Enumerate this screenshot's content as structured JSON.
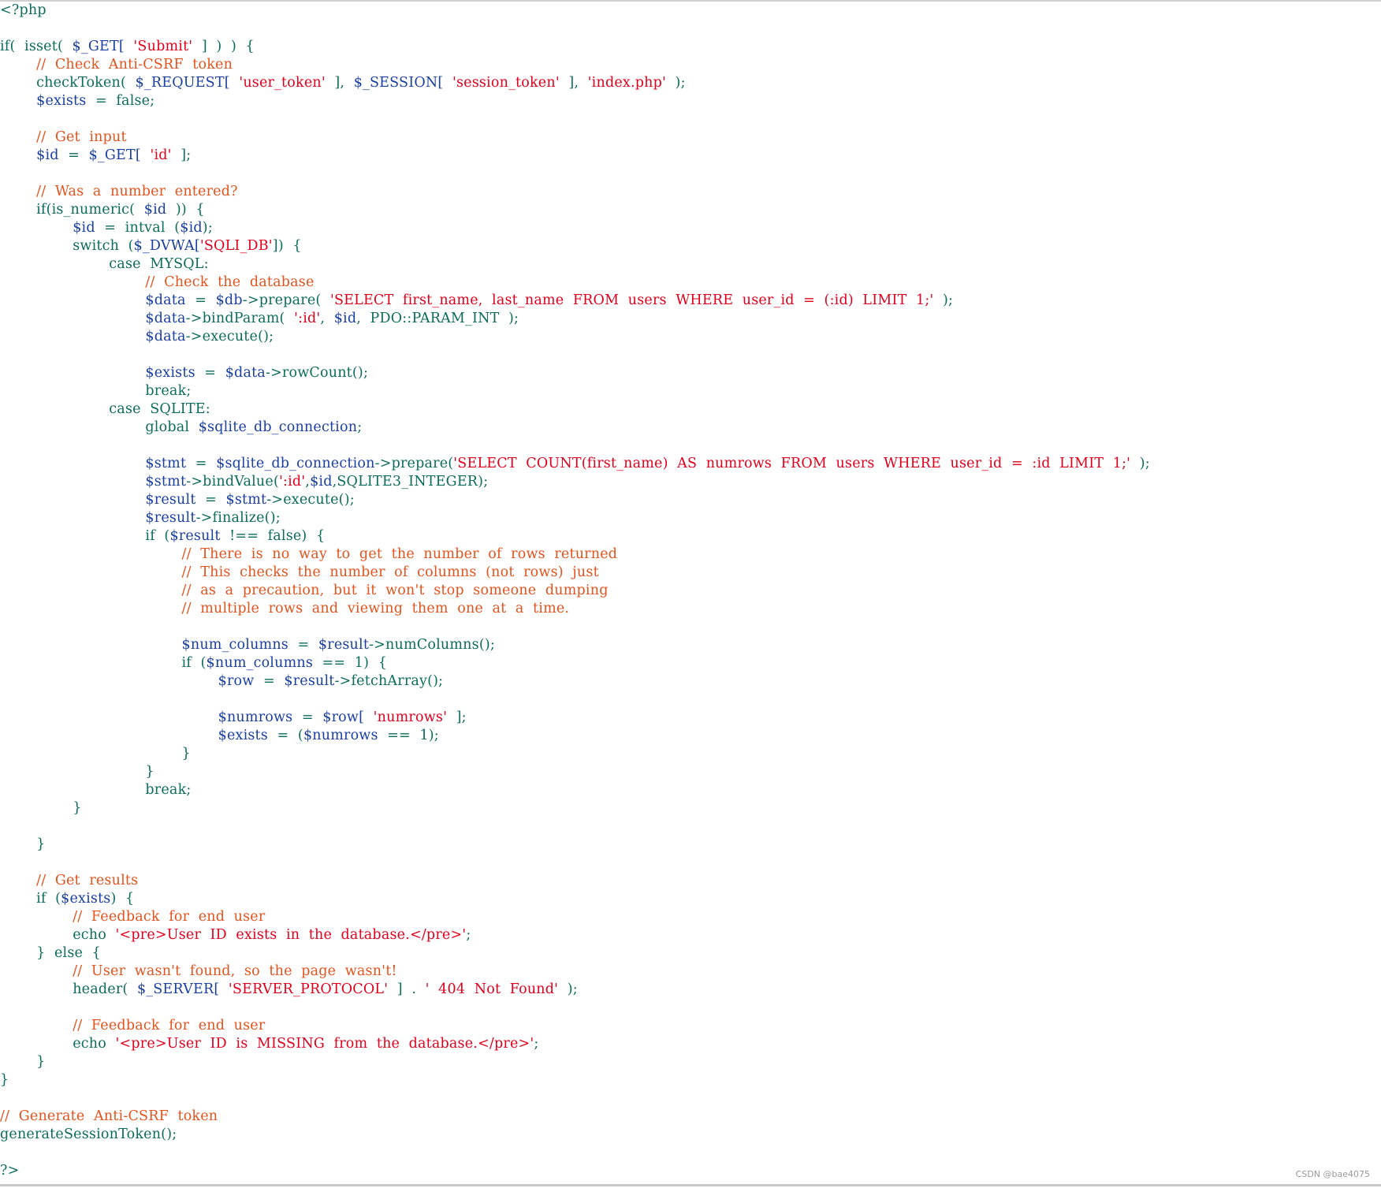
{
  "editor": {
    "lines": [
      [
        {
          "t": "<?php",
          "c": "default"
        }
      ],
      [],
      [
        {
          "t": "if(  isset(  ",
          "c": "default"
        },
        {
          "t": "$_GET[",
          "c": "variable"
        },
        {
          "t": "  ",
          "c": "default"
        },
        {
          "t": "'Submit'",
          "c": "string"
        },
        {
          "t": "  ]  )  )  {",
          "c": "default"
        }
      ],
      [
        {
          "t": "        //  Check  Anti-CSRF  token",
          "c": "comment"
        }
      ],
      [
        {
          "t": "        checkToken(  ",
          "c": "default"
        },
        {
          "t": "$_REQUEST[",
          "c": "variable"
        },
        {
          "t": "  ",
          "c": "default"
        },
        {
          "t": "'user_token'",
          "c": "string"
        },
        {
          "t": "  ],  ",
          "c": "default"
        },
        {
          "t": "$_SESSION[",
          "c": "variable"
        },
        {
          "t": "  ",
          "c": "default"
        },
        {
          "t": "'session_token'",
          "c": "string"
        },
        {
          "t": "  ],  ",
          "c": "default"
        },
        {
          "t": "'index.php'",
          "c": "string"
        },
        {
          "t": "  );",
          "c": "default"
        }
      ],
      [
        {
          "t": "        ",
          "c": "default"
        },
        {
          "t": "$exists",
          "c": "variable"
        },
        {
          "t": "  =  false;",
          "c": "default"
        }
      ],
      [],
      [
        {
          "t": "        //  Get  input",
          "c": "comment"
        }
      ],
      [
        {
          "t": "        ",
          "c": "default"
        },
        {
          "t": "$id",
          "c": "variable"
        },
        {
          "t": "  =  ",
          "c": "default"
        },
        {
          "t": "$_GET[",
          "c": "variable"
        },
        {
          "t": "  ",
          "c": "default"
        },
        {
          "t": "'id'",
          "c": "string"
        },
        {
          "t": "  ];",
          "c": "default"
        }
      ],
      [],
      [
        {
          "t": "        //  Was  a  number  entered?",
          "c": "comment"
        }
      ],
      [
        {
          "t": "        if(is_numeric(  ",
          "c": "default"
        },
        {
          "t": "$id",
          "c": "variable"
        },
        {
          "t": "  ))  {",
          "c": "default"
        }
      ],
      [
        {
          "t": "                ",
          "c": "default"
        },
        {
          "t": "$id",
          "c": "variable"
        },
        {
          "t": "  =  intval  (",
          "c": "default"
        },
        {
          "t": "$id",
          "c": "variable"
        },
        {
          "t": ");",
          "c": "default"
        }
      ],
      [
        {
          "t": "                switch  (",
          "c": "default"
        },
        {
          "t": "$_DVWA[",
          "c": "variable"
        },
        {
          "t": "'SQLI_DB'",
          "c": "string"
        },
        {
          "t": "])  {",
          "c": "default"
        }
      ],
      [
        {
          "t": "                        case  MYSQL:",
          "c": "default"
        }
      ],
      [
        {
          "t": "                                //  Check  the  database",
          "c": "comment"
        }
      ],
      [
        {
          "t": "                                ",
          "c": "default"
        },
        {
          "t": "$data",
          "c": "variable"
        },
        {
          "t": "  =  ",
          "c": "default"
        },
        {
          "t": "$db",
          "c": "variable"
        },
        {
          "t": "->prepare(  ",
          "c": "default"
        },
        {
          "t": "'SELECT  first_name,  last_name  FROM  users  WHERE  user_id  =  (:id)  LIMIT  1;'",
          "c": "string"
        },
        {
          "t": "  );",
          "c": "default"
        }
      ],
      [
        {
          "t": "                                ",
          "c": "default"
        },
        {
          "t": "$data",
          "c": "variable"
        },
        {
          "t": "->bindParam(  ",
          "c": "default"
        },
        {
          "t": "':id'",
          "c": "string"
        },
        {
          "t": ",  ",
          "c": "default"
        },
        {
          "t": "$id",
          "c": "variable"
        },
        {
          "t": ",  PDO::PARAM_INT  );",
          "c": "default"
        }
      ],
      [
        {
          "t": "                                ",
          "c": "default"
        },
        {
          "t": "$data",
          "c": "variable"
        },
        {
          "t": "->execute();",
          "c": "default"
        }
      ],
      [],
      [
        {
          "t": "                                ",
          "c": "default"
        },
        {
          "t": "$exists",
          "c": "variable"
        },
        {
          "t": "  =  ",
          "c": "default"
        },
        {
          "t": "$data",
          "c": "variable"
        },
        {
          "t": "->rowCount();",
          "c": "default"
        }
      ],
      [
        {
          "t": "                                break;",
          "c": "default"
        }
      ],
      [
        {
          "t": "                        case  SQLITE:",
          "c": "default"
        }
      ],
      [
        {
          "t": "                                global  ",
          "c": "default"
        },
        {
          "t": "$sqlite_db_connection",
          "c": "variable"
        },
        {
          "t": ";",
          "c": "default"
        }
      ],
      [],
      [
        {
          "t": "                                ",
          "c": "default"
        },
        {
          "t": "$stmt",
          "c": "variable"
        },
        {
          "t": "  =  ",
          "c": "default"
        },
        {
          "t": "$sqlite_db_connection",
          "c": "variable"
        },
        {
          "t": "->prepare(",
          "c": "default"
        },
        {
          "t": "'SELECT  COUNT(first_name)  AS  numrows  FROM  users  WHERE  user_id  =  :id  LIMIT  1;'",
          "c": "string"
        },
        {
          "t": "  );",
          "c": "default"
        }
      ],
      [
        {
          "t": "                                ",
          "c": "default"
        },
        {
          "t": "$stmt",
          "c": "variable"
        },
        {
          "t": "->bindValue(",
          "c": "default"
        },
        {
          "t": "':id'",
          "c": "string"
        },
        {
          "t": ",",
          "c": "default"
        },
        {
          "t": "$id",
          "c": "variable"
        },
        {
          "t": ",SQLITE3_INTEGER);",
          "c": "default"
        }
      ],
      [
        {
          "t": "                                ",
          "c": "default"
        },
        {
          "t": "$result",
          "c": "variable"
        },
        {
          "t": "  =  ",
          "c": "default"
        },
        {
          "t": "$stmt",
          "c": "variable"
        },
        {
          "t": "->execute();",
          "c": "default"
        }
      ],
      [
        {
          "t": "                                ",
          "c": "default"
        },
        {
          "t": "$result",
          "c": "variable"
        },
        {
          "t": "->finalize();",
          "c": "default"
        }
      ],
      [
        {
          "t": "                                if  (",
          "c": "default"
        },
        {
          "t": "$result",
          "c": "variable"
        },
        {
          "t": "  !==  false)  {",
          "c": "default"
        }
      ],
      [
        {
          "t": "                                        //  There  is  no  way  to  get  the  number  of  rows  returned",
          "c": "comment"
        }
      ],
      [
        {
          "t": "                                        //  This  checks  the  number  of  columns  (not  rows)  just",
          "c": "comment"
        }
      ],
      [
        {
          "t": "                                        //  as  a  precaution,  but  it  won't  stop  someone  dumping",
          "c": "comment"
        }
      ],
      [
        {
          "t": "                                        //  multiple  rows  and  viewing  them  one  at  a  time.",
          "c": "comment"
        }
      ],
      [],
      [
        {
          "t": "                                        ",
          "c": "default"
        },
        {
          "t": "$num_columns",
          "c": "variable"
        },
        {
          "t": "  =  ",
          "c": "default"
        },
        {
          "t": "$result",
          "c": "variable"
        },
        {
          "t": "->numColumns();",
          "c": "default"
        }
      ],
      [
        {
          "t": "                                        if  (",
          "c": "default"
        },
        {
          "t": "$num_columns",
          "c": "variable"
        },
        {
          "t": "  ==  1)  {",
          "c": "default"
        }
      ],
      [
        {
          "t": "                                                ",
          "c": "default"
        },
        {
          "t": "$row",
          "c": "variable"
        },
        {
          "t": "  =  ",
          "c": "default"
        },
        {
          "t": "$result",
          "c": "variable"
        },
        {
          "t": "->fetchArray();",
          "c": "default"
        }
      ],
      [],
      [
        {
          "t": "                                                ",
          "c": "default"
        },
        {
          "t": "$numrows",
          "c": "variable"
        },
        {
          "t": "  =  ",
          "c": "default"
        },
        {
          "t": "$row[",
          "c": "variable"
        },
        {
          "t": "  ",
          "c": "default"
        },
        {
          "t": "'numrows'",
          "c": "string"
        },
        {
          "t": "  ];",
          "c": "default"
        }
      ],
      [
        {
          "t": "                                                ",
          "c": "default"
        },
        {
          "t": "$exists",
          "c": "variable"
        },
        {
          "t": "  =  (",
          "c": "default"
        },
        {
          "t": "$numrows",
          "c": "variable"
        },
        {
          "t": "  ==  1);",
          "c": "default"
        }
      ],
      [
        {
          "t": "                                        }",
          "c": "default"
        }
      ],
      [
        {
          "t": "                                }",
          "c": "default"
        }
      ],
      [
        {
          "t": "                                break;",
          "c": "default"
        }
      ],
      [
        {
          "t": "                }",
          "c": "default"
        }
      ],
      [],
      [
        {
          "t": "        }",
          "c": "default"
        }
      ],
      [],
      [
        {
          "t": "        //  Get  results",
          "c": "comment"
        }
      ],
      [
        {
          "t": "        if  (",
          "c": "default"
        },
        {
          "t": "$exists",
          "c": "variable"
        },
        {
          "t": ")  {",
          "c": "default"
        }
      ],
      [
        {
          "t": "                //  Feedback  for  end  user",
          "c": "comment"
        }
      ],
      [
        {
          "t": "                echo  ",
          "c": "default"
        },
        {
          "t": "'<pre>User  ID  exists  in  the  database.</pre>'",
          "c": "string"
        },
        {
          "t": ";",
          "c": "default"
        }
      ],
      [
        {
          "t": "        }  else  {",
          "c": "default"
        }
      ],
      [
        {
          "t": "                //  User  wasn't  found,  so  the  page  wasn't!",
          "c": "comment"
        }
      ],
      [
        {
          "t": "                header(  ",
          "c": "default"
        },
        {
          "t": "$_SERVER[",
          "c": "variable"
        },
        {
          "t": "  ",
          "c": "default"
        },
        {
          "t": "'SERVER_PROTOCOL'",
          "c": "string"
        },
        {
          "t": "  ]  .  ",
          "c": "default"
        },
        {
          "t": "'  404  Not  Found'",
          "c": "string"
        },
        {
          "t": "  );",
          "c": "default"
        }
      ],
      [],
      [
        {
          "t": "                //  Feedback  for  end  user",
          "c": "comment"
        }
      ],
      [
        {
          "t": "                echo  ",
          "c": "default"
        },
        {
          "t": "'<pre>User  ID  is  MISSING  from  the  database.</pre>'",
          "c": "string"
        },
        {
          "t": ";",
          "c": "default"
        }
      ],
      [
        {
          "t": "        }",
          "c": "default"
        }
      ],
      [
        {
          "t": "}",
          "c": "default"
        }
      ],
      [],
      [
        {
          "t": "//  Generate  Anti-CSRF  token",
          "c": "comment"
        }
      ],
      [
        {
          "t": "generateSessionToken();",
          "c": "default"
        }
      ],
      [],
      [
        {
          "t": "?>",
          "c": "default"
        }
      ]
    ]
  },
  "watermark": "CSDN @bae4075",
  "colors": {
    "default": "#0b6b5d",
    "comment": "#e2531d",
    "string": "#e0001c",
    "variable": "#1a3fa3"
  }
}
